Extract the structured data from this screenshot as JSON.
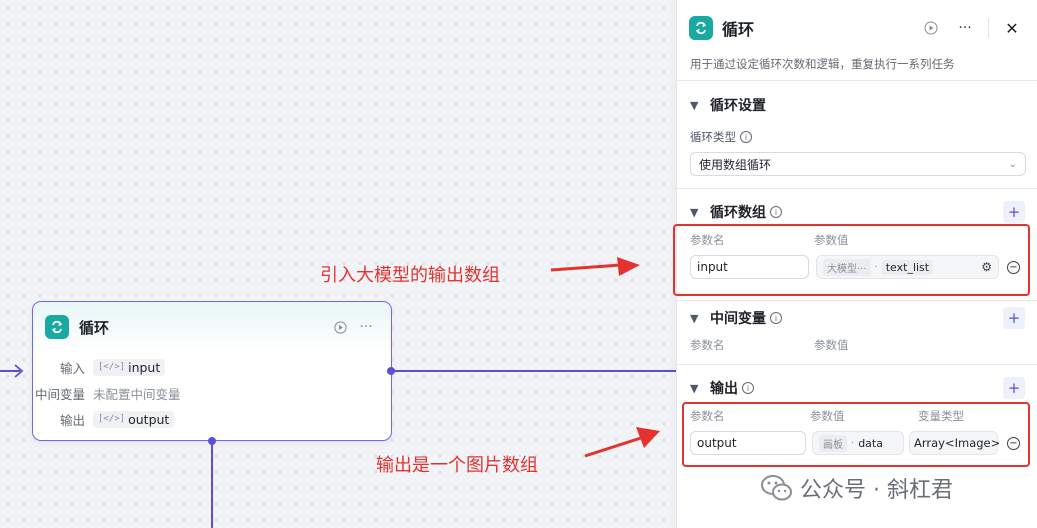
{
  "node": {
    "title": "循环",
    "rows": {
      "input_label": "输入",
      "input_value": "input",
      "var_label": "中间变量",
      "var_value": "未配置中间变量",
      "output_label": "输出",
      "output_value": "output"
    }
  },
  "annotations": {
    "top": "引入大模型的输出数组",
    "bottom": "输出是一个图片数组"
  },
  "panel": {
    "title": "循环",
    "description": "用于通过设定循环次数和逻辑，重复执行一系列任务",
    "settings": {
      "title": "循环设置",
      "type_label": "循环类型",
      "type_value": "使用数组循环"
    },
    "array": {
      "title": "循环数组",
      "col_name": "参数名",
      "col_value": "参数值",
      "param_name": "input",
      "ref_source": "大模型···",
      "ref_value": "text_list"
    },
    "middle": {
      "title": "中间变量",
      "col_name": "参数名",
      "col_value": "参数值"
    },
    "output": {
      "title": "输出",
      "col_name": "参数名",
      "col_value": "参数值",
      "col_type": "变量类型",
      "param_name": "output",
      "ref_source": "画板",
      "ref_value": "data",
      "type_value": "Array<Image>"
    }
  },
  "watermark": "公众号 · 斜杠君",
  "colors": {
    "accent": "#5a50d8",
    "brand_icon": "#18a9a0",
    "annotation": "#e4332f"
  },
  "icons": [
    "loop-icon",
    "play-icon",
    "more-icon",
    "close-icon",
    "chevron-down-icon",
    "info-icon",
    "plus-icon",
    "gear-icon",
    "minus-circle-icon",
    "array-icon",
    "arrow-icon",
    "wechat-icon"
  ]
}
